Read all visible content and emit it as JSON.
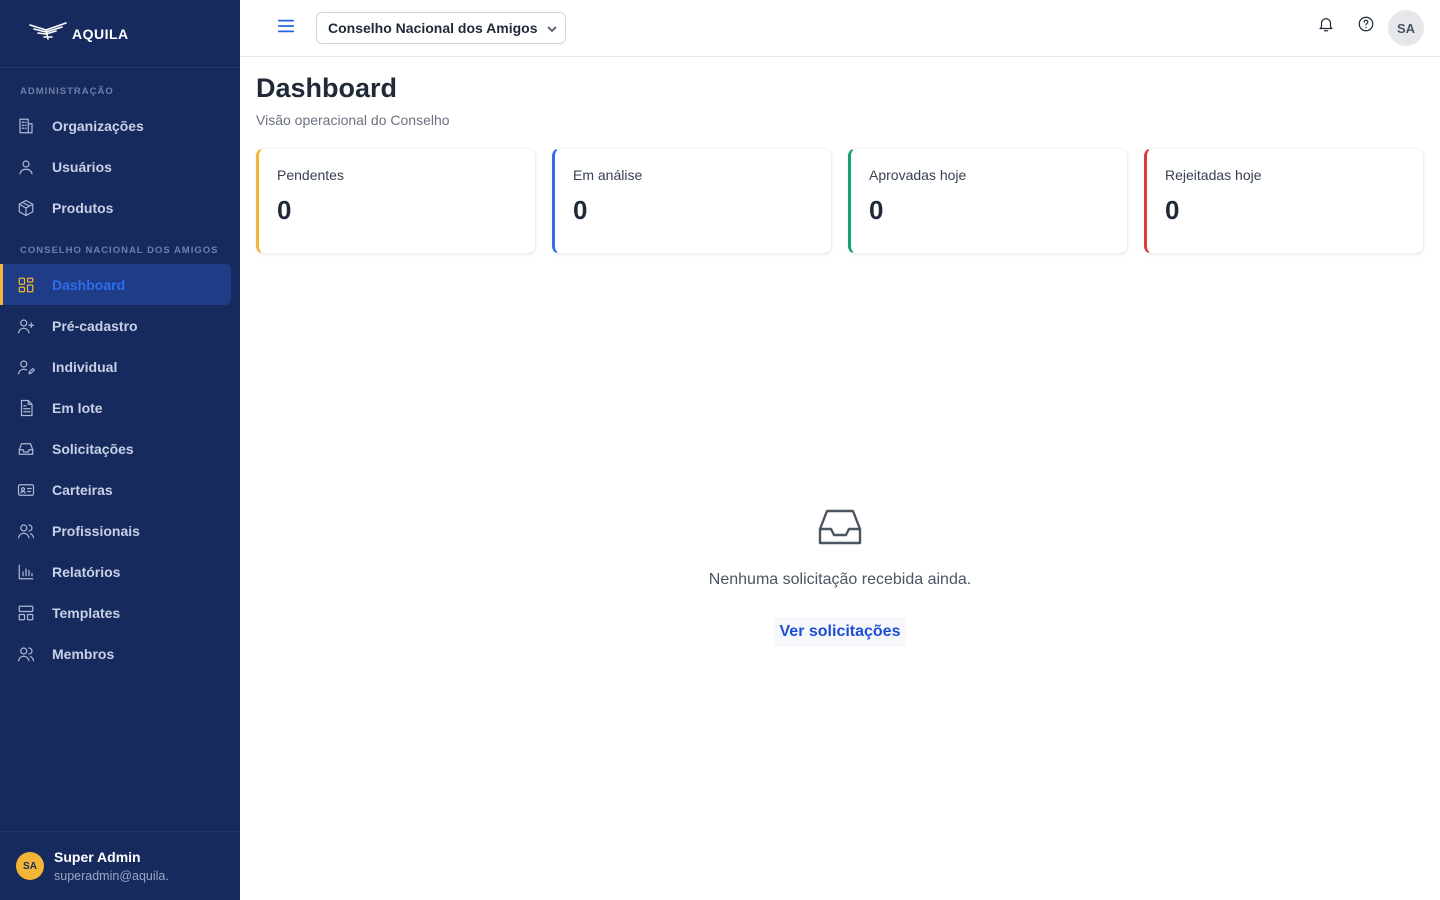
{
  "brand": {
    "name": "AQUILA"
  },
  "sidebar": {
    "sections": [
      {
        "label": "ADMINISTRAÇÃO",
        "items": [
          {
            "label": "Organizações",
            "icon": "building-icon"
          },
          {
            "label": "Usuários",
            "icon": "user-icon"
          },
          {
            "label": "Produtos",
            "icon": "package-icon"
          }
        ]
      },
      {
        "label": "CONSELHO NACIONAL DOS AMIGOS",
        "items": [
          {
            "label": "Dashboard",
            "icon": "grid-icon",
            "active": true
          },
          {
            "label": "Pré-cadastro",
            "icon": "user-plus-icon"
          },
          {
            "label": "Individual",
            "icon": "user-edit-icon"
          },
          {
            "label": "Em lote",
            "icon": "file-icon"
          },
          {
            "label": "Solicitações",
            "icon": "inbox-icon"
          },
          {
            "label": "Carteiras",
            "icon": "id-card-icon"
          },
          {
            "label": "Profissionais",
            "icon": "users-icon"
          },
          {
            "label": "Relatórios",
            "icon": "bar-chart-icon"
          },
          {
            "label": "Templates",
            "icon": "layout-icon"
          },
          {
            "label": "Membros",
            "icon": "members-icon"
          }
        ]
      }
    ],
    "user": {
      "initials": "SA",
      "name": "Super Admin",
      "email": "superadmin@aquila."
    }
  },
  "topbar": {
    "org_selected": "Conselho Nacional dos Amigos",
    "avatar_initials": "SA"
  },
  "main": {
    "title": "Dashboard",
    "subtitle": "Visão operacional do Conselho",
    "cards": [
      {
        "label": "Pendentes",
        "value": "0",
        "color": "#f2b535"
      },
      {
        "label": "Em análise",
        "value": "0",
        "color": "#2f6cf0"
      },
      {
        "label": "Aprovadas hoje",
        "value": "0",
        "color": "#16a36a"
      },
      {
        "label": "Rejeitadas hoje",
        "value": "0",
        "color": "#dc3b3b"
      }
    ],
    "empty_state": {
      "message": "Nenhuma solicitação recebida ainda.",
      "link": "Ver solicitações"
    }
  }
}
